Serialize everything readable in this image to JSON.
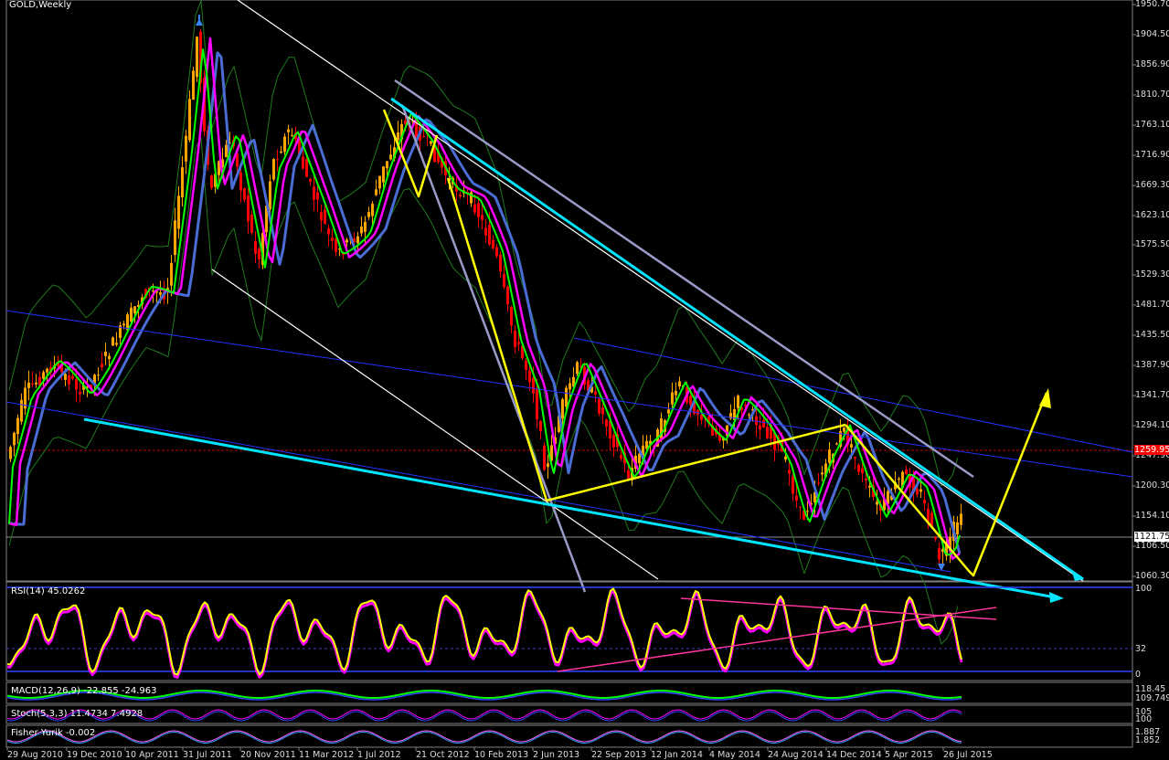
{
  "window": {
    "title": "GOLD,Weekly"
  },
  "price_axis": {
    "labels": [
      "1950.70",
      "1904.50",
      "1856.90",
      "1810.70",
      "1763.10",
      "1716.90",
      "1669.30",
      "1623.10",
      "1575.50",
      "1529.30",
      "1481.70",
      "1435.50",
      "1387.90",
      "1341.70",
      "1294.10",
      "1247.90",
      "1200.30",
      "1154.10",
      "1106.50",
      "1060.30"
    ],
    "current_price": "1121.75",
    "line_price": "1259.95"
  },
  "indicators": {
    "rsi": {
      "label": "RSI(14) 45.0262",
      "levels": [
        "100",
        "32",
        "0"
      ]
    },
    "macd": {
      "label": "MACD(12,26,9) -22.855 -24.963",
      "levels": [
        "118.45",
        "109.749"
      ]
    },
    "stoch": {
      "label": "Stoch(5,3,3) 11.4734 7.4928",
      "levels": [
        "105",
        "100"
      ]
    },
    "fisher": {
      "label": "Fisher Yurik -0.002",
      "levels": [
        "1.887",
        "1.852"
      ]
    }
  },
  "time_axis": {
    "labels": [
      "29 Aug 2010",
      "19 Dec 2010",
      "10 Apr 2011",
      "31 Jul 2011",
      "20 Nov 2011",
      "11 Mar 2012",
      "1 Jul 2012",
      "21 Oct 2012",
      "10 Feb 2013",
      "2 Jun 2013",
      "22 Sep 2013",
      "12 Jan 2014",
      "4 May 2014",
      "24 Aug 2014",
      "14 Dec 2014",
      "5 Apr 2015",
      "26 Jul 2015"
    ]
  },
  "colors": {
    "background": "#000000",
    "bull_candle": "#ffa500",
    "bear_candle": "#ff0000",
    "ema_fast": "#00ff00",
    "ema_mid": "#ff00ff",
    "ema_slow": "#4a6cd4",
    "trend_cyan": "#00e5ff",
    "trend_yellow": "#ffff00",
    "trend_grey": "#9a9ac8",
    "trend_white": "#ffffff",
    "bollinger": "#1e7a1e"
  }
}
